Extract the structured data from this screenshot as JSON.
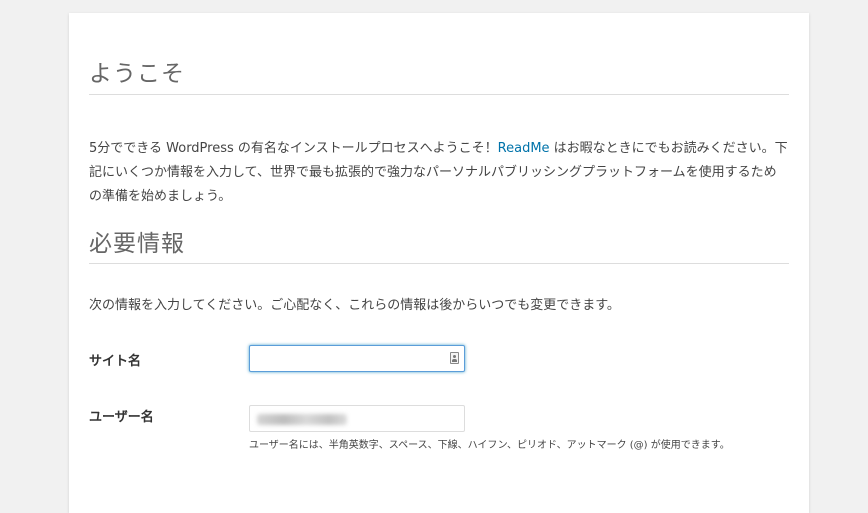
{
  "welcome": {
    "heading": "ようこそ",
    "intro_before_link": "5分でできる WordPress の有名なインストールプロセスへようこそ！",
    "readme_link": "ReadMe",
    "intro_after_link": " はお暇なときにでもお読みください。下記にいくつか情報を入力して、世界で最も拡張的で強力なパーソナルパブリッシングプラットフォームを使用するための準備を始めましょう。"
  },
  "required_info": {
    "heading": "必要情報",
    "note": "次の情報を入力してください。ご心配なく、これらの情報は後からいつでも変更できます。"
  },
  "form": {
    "site_title": {
      "label": "サイト名",
      "value": "",
      "icon": "contact-card-icon"
    },
    "username": {
      "label": "ユーザー名",
      "value_obscured": true,
      "hint": "ユーザー名には、半角英数字、スペース、下線、ハイフン、ピリオド、アットマーク (@) が使用できます。"
    }
  },
  "colors": {
    "page_background": "#f1f1f1",
    "card_background": "#ffffff",
    "link": "#0073aa",
    "focus_border": "#5b9dd9",
    "heading": "#666666"
  }
}
